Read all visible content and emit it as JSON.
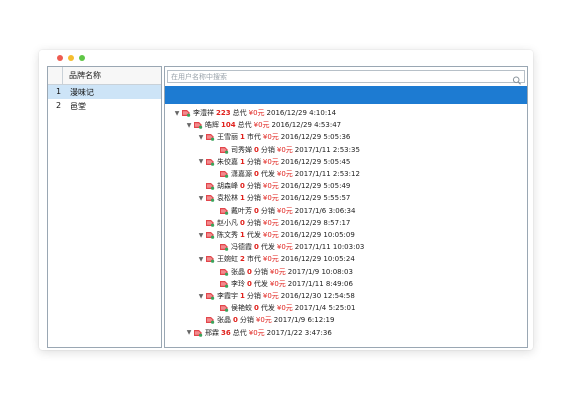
{
  "colors": {
    "accent_bar": "#1d7bd2",
    "highlight_red": "#e0201b",
    "selected_row": "#cde4f7"
  },
  "left_panel": {
    "header": "品牌名称",
    "rows": [
      {
        "num": "1",
        "name": "漫味记"
      },
      {
        "num": "2",
        "name": "邑堂"
      }
    ]
  },
  "search": {
    "placeholder": "在用户名称中搜索"
  },
  "tree": [
    {
      "name": "李澧祥",
      "count": "223",
      "type": "总代",
      "money": "¥0元",
      "date": "2016/12/29 4:10:14"
    },
    {
      "name": "皓辉",
      "count": "104",
      "type": "总代",
      "money": "¥0元",
      "date": "2016/12/29 4:53:47"
    },
    {
      "name": "王雪丽",
      "count": "1",
      "type": "市代",
      "money": "¥0元",
      "date": "2016/12/29 5:05:36"
    },
    {
      "name": "司秀婵",
      "count": "0",
      "type": "分销",
      "money": "¥0元",
      "date": "2017/1/11 2:53:35"
    },
    {
      "name": "朱佼嘉",
      "count": "1",
      "type": "分销",
      "money": "¥0元",
      "date": "2016/12/29 5:05:45"
    },
    {
      "name": "潇嘉源",
      "count": "0",
      "type": "代发",
      "money": "¥0元",
      "date": "2017/1/11 2:53:12"
    },
    {
      "name": "胡森峰",
      "count": "0",
      "type": "分销",
      "money": "¥0元",
      "date": "2016/12/29 5:05:49"
    },
    {
      "name": "袁松林",
      "count": "1",
      "type": "分销",
      "money": "¥0元",
      "date": "2016/12/29 5:55:57"
    },
    {
      "name": "戴叶芳",
      "count": "0",
      "type": "分销",
      "money": "¥0元",
      "date": "2017/1/6 3:06:34"
    },
    {
      "name": "赵小凡",
      "count": "0",
      "type": "分销",
      "money": "¥0元",
      "date": "2016/12/29 8:57:17"
    },
    {
      "name": "陈文秀",
      "count": "1",
      "type": "代发",
      "money": "¥0元",
      "date": "2016/12/29 10:05:09"
    },
    {
      "name": "冯德霞",
      "count": "0",
      "type": "代发",
      "money": "¥0元",
      "date": "2017/1/11 10:03:03"
    },
    {
      "name": "王婉虹",
      "count": "2",
      "type": "市代",
      "money": "¥0元",
      "date": "2016/12/29 10:05:24"
    },
    {
      "name": "张晶",
      "count": "0",
      "type": "分销",
      "money": "¥0元",
      "date": "2017/1/9 10:08:03"
    },
    {
      "name": "李玲",
      "count": "0",
      "type": "代发",
      "money": "¥0元",
      "date": "2017/1/11 8:49:06"
    },
    {
      "name": "李霞宇",
      "count": "1",
      "type": "分销",
      "money": "¥0元",
      "date": "2016/12/30 12:54:58"
    },
    {
      "name": "侯艳蛟",
      "count": "0",
      "type": "代发",
      "money": "¥0元",
      "date": "2017/1/4 5:25:01"
    },
    {
      "name": "张晶",
      "count": "0",
      "type": "分销",
      "money": "¥0元",
      "date": "2017/1/9 6:12:19"
    },
    {
      "name": "邢霖",
      "count": "36",
      "type": "总代",
      "money": "¥0元",
      "date": "2017/1/22 3:47:36"
    }
  ]
}
